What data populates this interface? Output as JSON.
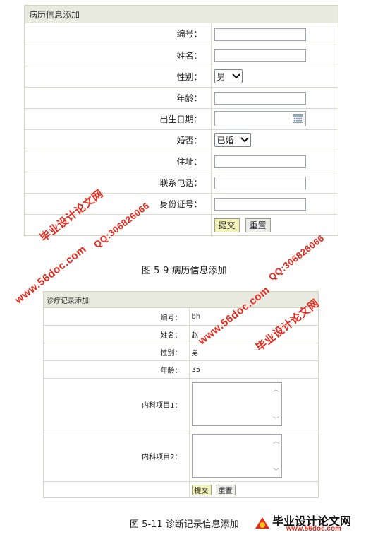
{
  "form1": {
    "title": "病历信息添加",
    "fields": [
      {
        "label": "编号：",
        "type": "text",
        "value": ""
      },
      {
        "label": "姓名：",
        "type": "text",
        "value": ""
      },
      {
        "label": "性别：",
        "type": "select",
        "value": "男"
      },
      {
        "label": "年龄：",
        "type": "text",
        "value": ""
      },
      {
        "label": "出生日期：",
        "type": "date",
        "value": ""
      },
      {
        "label": "婚否：",
        "type": "select",
        "value": "已婚"
      },
      {
        "label": "住址：",
        "type": "text",
        "value": ""
      },
      {
        "label": "联系电话：",
        "type": "text",
        "value": ""
      },
      {
        "label": "身份证号：",
        "type": "text",
        "value": ""
      }
    ],
    "submit_label": "提交",
    "reset_label": "重置"
  },
  "caption1": "图 5-9  病历信息添加",
  "form2": {
    "title": "诊疗记录添加",
    "fields": [
      {
        "label": "编号：",
        "value": "bh"
      },
      {
        "label": "姓名：",
        "value": "赵"
      },
      {
        "label": "性别：",
        "value": "男"
      },
      {
        "label": "年龄：",
        "value": "35"
      }
    ],
    "textareas": [
      {
        "label": "内科项目1：",
        "value": ""
      },
      {
        "label": "内科项目2：",
        "value": ""
      }
    ],
    "submit_label": "提交",
    "reset_label": "重置"
  },
  "caption2": "图 5-11  诊断记录信息添加",
  "watermarks": {
    "site_name": "毕业设计论文网",
    "site_url": "www.56doc.com",
    "qq": "QQ:306826066",
    "logo_url": "www.56doc.com"
  },
  "colors": {
    "watermark": "#e8281c",
    "header_bg": "#e9eadf",
    "submit_bg": "#f3f3b8"
  }
}
